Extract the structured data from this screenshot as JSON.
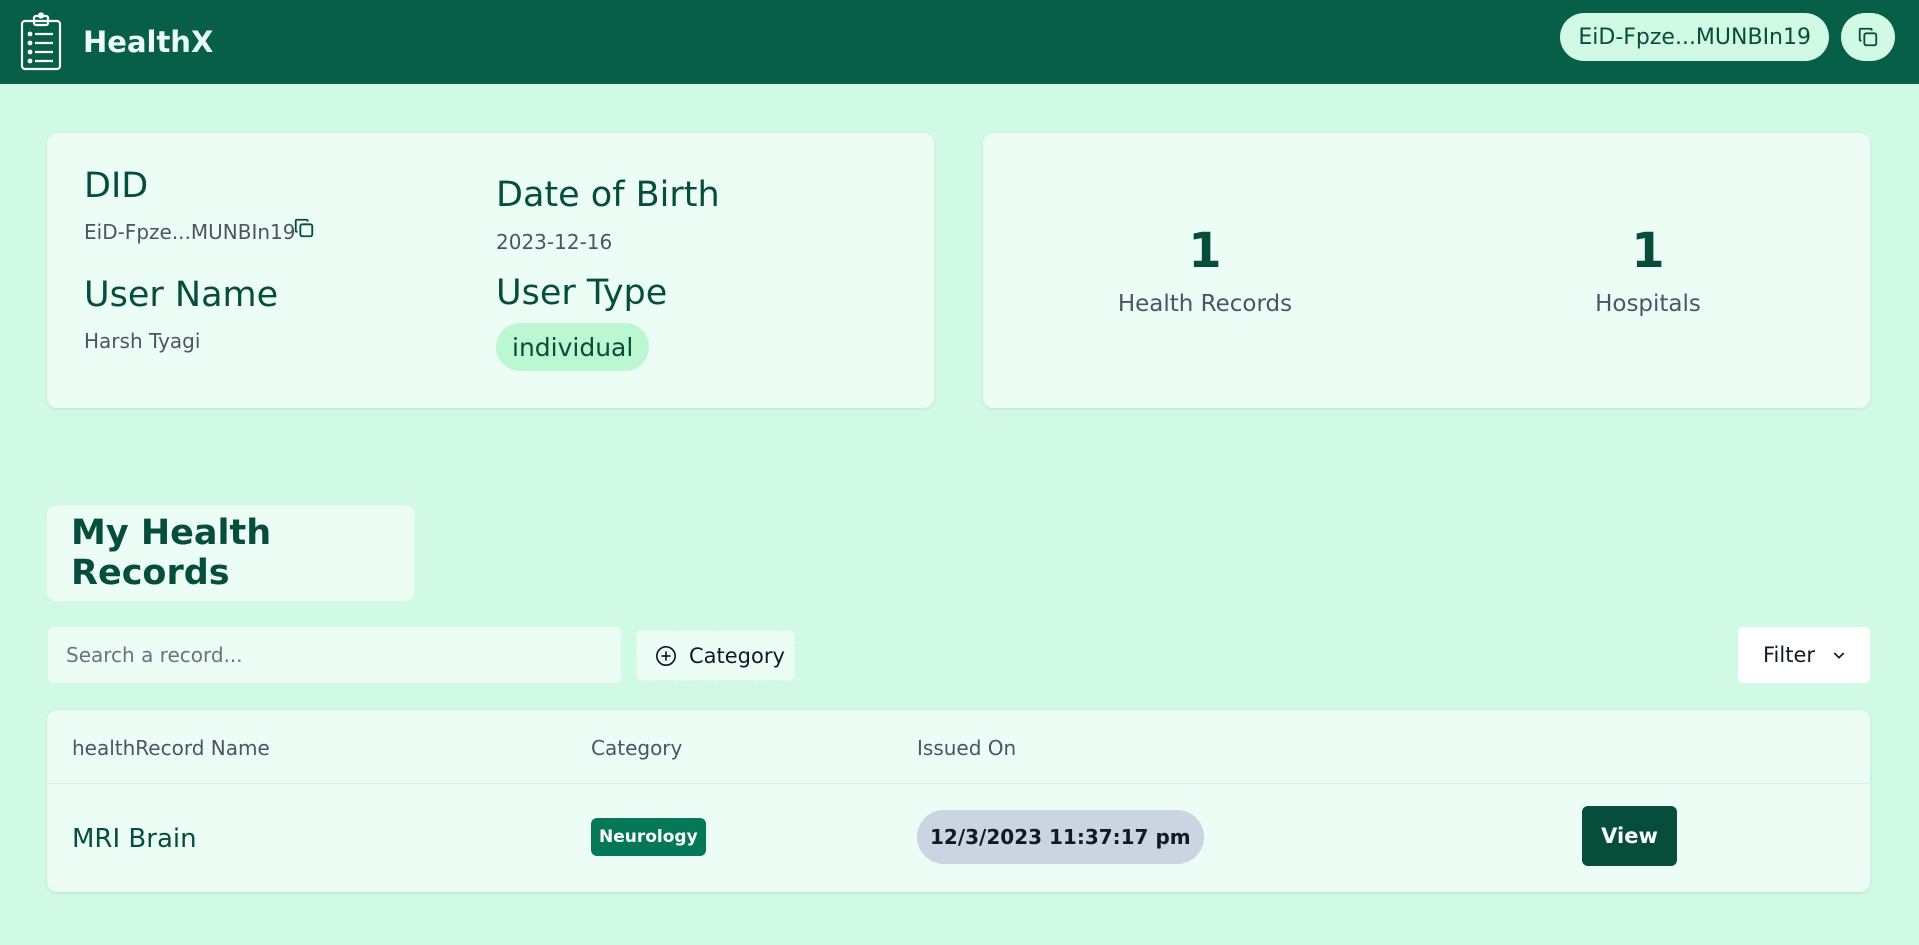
{
  "header": {
    "app_name": "HealthX",
    "did_short": "EiD-Fpze...MUNBIn19",
    "logo_icon": "clipboard-icon",
    "copy_icon": "copy-icon"
  },
  "profile": {
    "did_label": "DID",
    "did_value": "EiD-Fpze...MUNBIn19",
    "dob_label": "Date of Birth",
    "dob_value": "2023-12-16",
    "username_label": "User Name",
    "username_value": "Harsh Tyagi",
    "usertype_label": "User Type",
    "usertype_value": "individual"
  },
  "stats": [
    {
      "value": "1",
      "label": "Health Records"
    },
    {
      "value": "1",
      "label": "Hospitals"
    }
  ],
  "records_section": {
    "title": "My Health Records",
    "search_placeholder": "Search a record...",
    "category_button": "Category",
    "filter_button": "Filter"
  },
  "table": {
    "columns": [
      "healthRecord Name",
      "Category",
      "Issued On"
    ],
    "rows": [
      {
        "name": "MRI Brain",
        "category": "Neurology",
        "issued_on": "12/3/2023 11:37:17 pm",
        "action": "View"
      }
    ]
  },
  "colors": {
    "header_bg": "#065f46",
    "page_bg": "#d1fae5",
    "card_bg": "#ecfdf5",
    "accent_dark": "#064e3b",
    "badge_green": "#047857",
    "date_pill": "#cbd5e1"
  }
}
